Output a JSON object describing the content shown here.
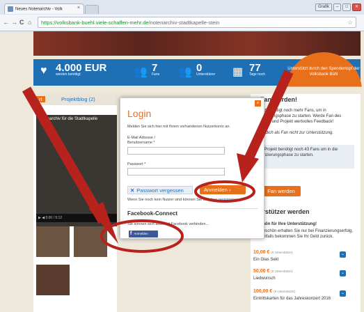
{
  "browser": {
    "tab_title": "Neues Notenarchiv - Volk",
    "tab_close": "×",
    "window_buttons": [
      "Grafik",
      "–",
      "□",
      "✕"
    ],
    "url_host": "https://volksbank-buehl.viele-schaffen-mehr.de",
    "url_path": "/notenarchiv-stadtkapelle-stein",
    "nav": [
      "←",
      "→",
      "C",
      "⌂",
      "🔒"
    ],
    "star_icon": "☆"
  },
  "stats": {
    "amount": "4.000 EUR",
    "amount_sub": "werden benötigt",
    "fans": "7",
    "fans_sub": "Fans",
    "supporters": "0",
    "supporters_sub": "Unterstützer",
    "days": "77",
    "days_sub": "Tage noch",
    "badge": "Unterstützt durch den Spendentopf der Volksbank Bühl"
  },
  "tabs": {
    "t1": "rt",
    "t2": "Projektblog (2)"
  },
  "video": {
    "title": "Notenarchiv für die Stadtkapelle",
    "time": "0:00 / 5:12"
  },
  "right": {
    "fan_heading": "zt Fan werden!",
    "p1": "Projekt benötigt noch mehr Fans, um in Finanzierungsphase zu starten. Werde Fan des Projektes und Projekt wertvolles Feedback!",
    "p2": "Klicke dich als Fan nicht zur Unterstützung.",
    "box": "Das Projekt benötigt noch 43 Fans um in die Finanzierungsphase zu starten.",
    "fan_button": "Fan werden",
    "supporters_heading": "nterstützer werden",
    "thanks_heading": "keschön für Ihre Unterstützung!",
    "thanks_text": "Dankeschön erhalten Sie nur bei Finanzierungserfolg, andernfalls bekommen Sie Ihr Geld zurück.",
    "rewards": [
      {
        "price": "10,00 €",
        "count": "(0 Unterstützer)",
        "name": "Ein Glas Sekt"
      },
      {
        "price": "50,00 €",
        "count": "(0 Unterstützer)",
        "name": "Liedwunsch"
      },
      {
        "price": "100,00 €",
        "count": "(0 Unterstützer)",
        "name": "Eintrittskarten für das Jahreskonzert 2016"
      }
    ]
  },
  "modal": {
    "title": "Login",
    "intro": "Melden Sie sich hier mit Ihrem vorhandenen Nutzerkonto an.",
    "email_label": "E-Mail Adresse /",
    "user_label": "Benutzername *",
    "password_label": "Passwort *",
    "forgot": "Passwort vergessen",
    "login": "Anmelden",
    "register_text": "Wenn Sie noch kein Nutzer sind können Sie sich",
    "register_link": "hier registrieren.",
    "fb_title": "Facebook-Connect",
    "fb_text": "Sie können sich auch mit Facebook verbinden...",
    "fb_button": "Anmelden"
  },
  "colors": {
    "accent": "#e8701a",
    "brand": "#1f6fb4",
    "annotation": "#b7221c"
  }
}
